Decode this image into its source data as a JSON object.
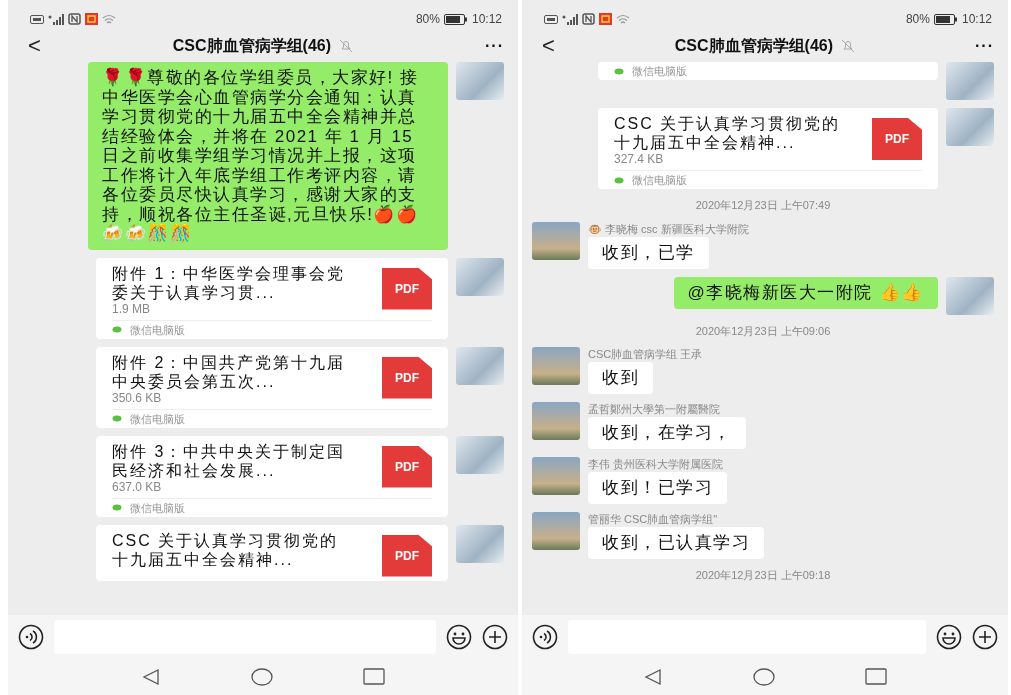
{
  "screens": [
    {
      "status_bar": {
        "battery": "80%",
        "time": "10:12"
      },
      "header": {
        "back": "<",
        "title": "CSC肺血管病学组(46)",
        "more": "···"
      },
      "messages": [
        {
          "kind": "text",
          "outgoing": true,
          "text": "🌹🌹尊敬的各位学组委员，大家好! 接中华医学会心血管病学分会通知：认真学习贯彻党的十九届五中全会精神并总结经验体会，并将在 2021 年 1 月 15 日之前收集学组学习情况并上报，这项工作将计入年底学组工作考评内容，请各位委员尽快认真学习，感谢大家的支持，顺祝各位主任圣诞,元旦快乐!🍎🍎🍻🍻🎊🎊"
        },
        {
          "kind": "file",
          "outgoing": true,
          "title": "附件 1：中华医学会理事会党委关于认真学习贯...",
          "size": "1.9 MB",
          "badge": "PDF",
          "source": "微信电脑版"
        },
        {
          "kind": "file",
          "outgoing": true,
          "title": "附件 2：中国共产党第十九届中央委员会第五次...",
          "size": "350.6 KB",
          "badge": "PDF",
          "source": "微信电脑版"
        },
        {
          "kind": "file",
          "outgoing": true,
          "title": "附件 3：中共中央关于制定国民经济和社会发展...",
          "size": "637.0 KB",
          "badge": "PDF",
          "source": "微信电脑版"
        },
        {
          "kind": "file",
          "outgoing": true,
          "title": "CSC 关于认真学习贯彻党的十九届五中全会精神...",
          "badge": "PDF"
        }
      ]
    },
    {
      "status_bar": {
        "battery": "80%",
        "time": "10:12"
      },
      "header": {
        "back": "<",
        "title": "CSC肺血管病学组(46)",
        "more": "···"
      },
      "messages": [
        {
          "kind": "file",
          "outgoing": true,
          "source": "微信电脑版"
        },
        {
          "kind": "file",
          "outgoing": true,
          "title": "CSC 关于认真学习贯彻党的十九届五中全会精神...",
          "size": "327.4 KB",
          "badge": "PDF",
          "source": "微信电脑版"
        },
        {
          "kind": "time",
          "text": "2020年12月23日 上午07:49"
        },
        {
          "kind": "text",
          "outgoing": false,
          "sender": "🐵 李晓梅 csc 新疆医科大学附院",
          "text": "收到，已学"
        },
        {
          "kind": "text",
          "outgoing": true,
          "text": "@李晓梅新医大一附院 👍👍"
        },
        {
          "kind": "time",
          "text": "2020年12月23日 上午09:06"
        },
        {
          "kind": "text",
          "outgoing": false,
          "sender": "CSC肺血管病学组 王承",
          "text": "收到"
        },
        {
          "kind": "text",
          "outgoing": false,
          "sender": "孟哲鄭州大學第一附屬醫院",
          "text": "收到，在学习，"
        },
        {
          "kind": "text",
          "outgoing": false,
          "sender": "李伟  贵州医科大学附属医院",
          "text": "收到！已学习"
        },
        {
          "kind": "text",
          "outgoing": false,
          "sender": "管丽华 CSC肺血管病学组\"",
          "text": "收到，已认真学习"
        },
        {
          "kind": "time",
          "text": "2020年12月23日 上午09:18"
        }
      ]
    }
  ]
}
